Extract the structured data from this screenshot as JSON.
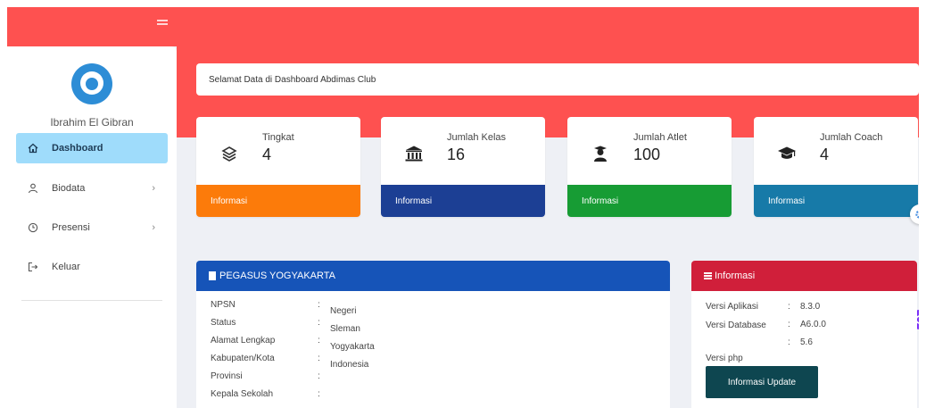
{
  "sidebar": {
    "username": "Ibrahim El Gibran",
    "items": [
      {
        "label": "Dashboard",
        "icon": "home-icon",
        "active": true
      },
      {
        "label": "Biodata",
        "icon": "user-icon",
        "chevron": "›"
      },
      {
        "label": "Presensi",
        "icon": "clock-icon",
        "chevron": "›"
      },
      {
        "label": "Keluar",
        "icon": "logout-icon"
      }
    ]
  },
  "welcome": {
    "text": "Selamat Data di Dashboard Abdimas Club"
  },
  "cards": [
    {
      "title": "Tingkat",
      "value": "4",
      "footer": "Informasi",
      "icon": "layers-icon",
      "color": "#fc7b0a"
    },
    {
      "title": "Jumlah Kelas",
      "value": "16",
      "footer": "Informasi",
      "icon": "institution-icon",
      "color": "#1c3f94"
    },
    {
      "title": "Jumlah Atlet",
      "value": "100",
      "footer": "Informasi",
      "icon": "athlete-icon",
      "color": "#179c34"
    },
    {
      "title": "Jumlah Coach",
      "value": "4",
      "footer": "Informasi",
      "icon": "graduation-cap-icon",
      "color": "#177aa8"
    }
  ],
  "school_panel": {
    "title": "PEGASUS YOGYAKARTA",
    "color": "#1654b8",
    "keys": [
      "NPSN",
      "Status",
      "Alamat Lengkap",
      "Kabupaten/Kota",
      "Provinsi",
      "Kepala Sekolah"
    ],
    "colon": ":",
    "values": [
      "Negeri",
      "Sleman",
      "Yogyakarta",
      "Indonesia"
    ]
  },
  "info_panel": {
    "title": "Informasi",
    "color": "#d01f3a",
    "rows": [
      {
        "key": "Versi Aplikasi",
        "colon": ":",
        "value": "8.3.0"
      },
      {
        "key": "Versi Database",
        "colon": ":",
        "value": "A6.0.0"
      },
      {
        "key": "",
        "colon": ":",
        "value": "5.6"
      },
      {
        "key": "Versi php",
        "colon": "",
        "value": ""
      }
    ],
    "button_label": "Informasi Update",
    "button_color": "#0e4650"
  },
  "float_buttons": [
    {
      "icon": "settings-gear-icon",
      "color": "#4a90e2"
    },
    {
      "icon": "chat-icon",
      "color": "#7b2ff7"
    }
  ]
}
